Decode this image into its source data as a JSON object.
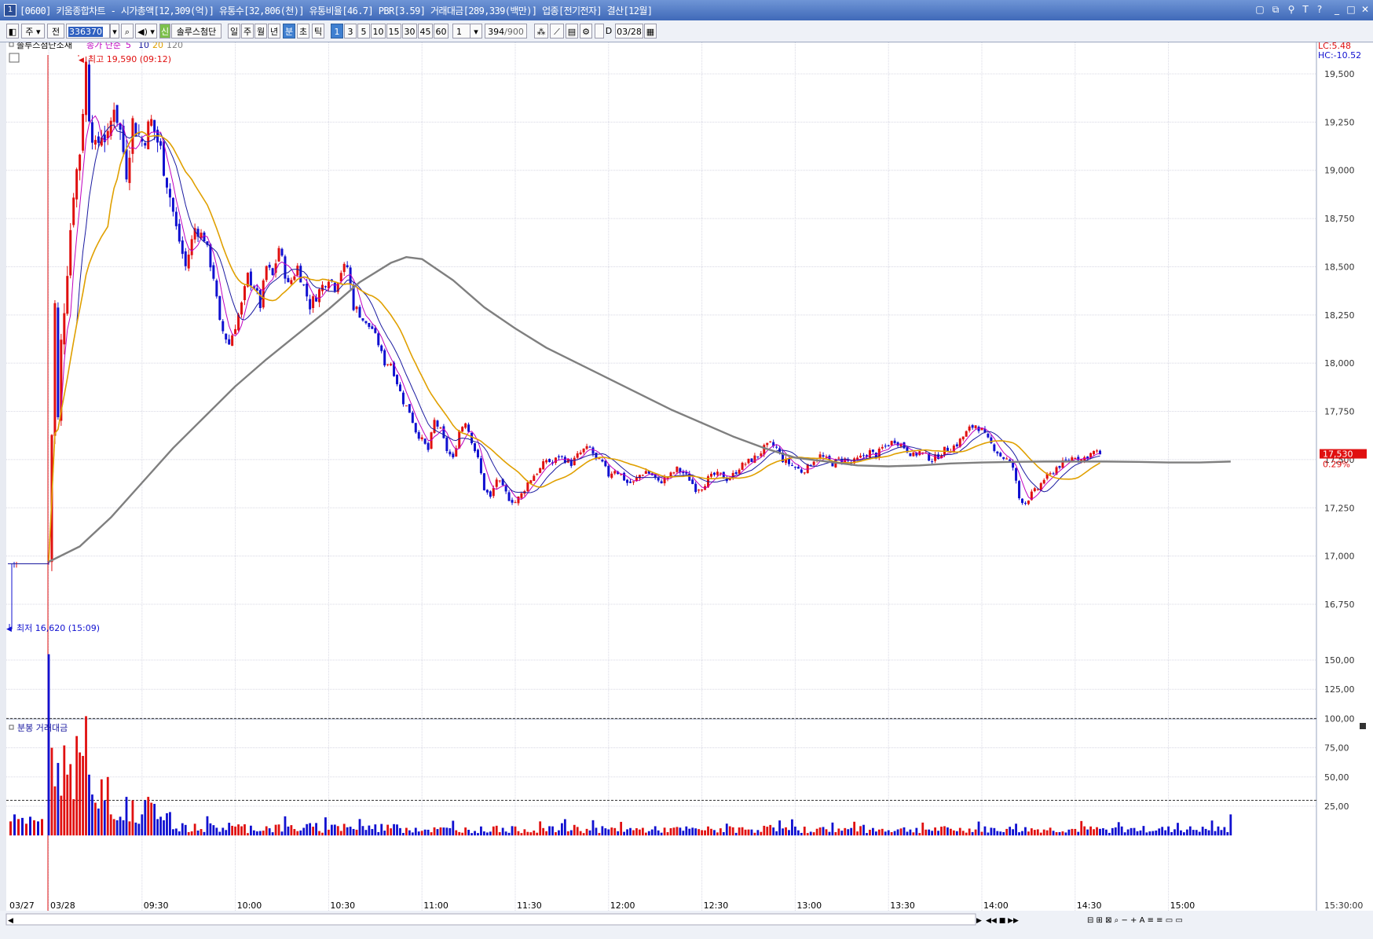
{
  "window": {
    "number": "1",
    "title": "[0600] 키움종합차트 - 시가총액[12,309(억)] 유통수[32,806(천)] 유통비율[46.7] PBR[3.59] 거래대금[289,339(백만)] 업종[전기전자] 결산[12월]",
    "buttons": [
      "restore-icon",
      "tile-icon",
      "pin-icon",
      "font-icon",
      "help-icon",
      "minimize-icon",
      "maximize-icon",
      "close-icon"
    ]
  },
  "toolbar": {
    "market": "주",
    "all": "전",
    "code": "336370",
    "shin": "신",
    "stock_name": "솔루스첨단",
    "periods": [
      "일",
      "주",
      "월",
      "년",
      "분",
      "초",
      "틱"
    ],
    "selected_period": "분",
    "intervals": [
      "1",
      "3",
      "5",
      "10",
      "15",
      "30",
      "45",
      "60"
    ],
    "selected_interval": "1",
    "multiplier": "1",
    "count": "394",
    "count_max": "/900",
    "d_label": "D",
    "date": "03/28"
  },
  "legend": {
    "name": "솔루스첨단소재",
    "ma_label": "종가 단순",
    "ma_periods": [
      "5",
      "10",
      "20",
      "120"
    ],
    "ma_colors": [
      "#c000c0",
      "#1a1aa0",
      "#e0a000",
      "#7f7f7f"
    ]
  },
  "annotations": {
    "high": "최고 19,590 (09:12)",
    "low": "최저 16,620 (15:09)",
    "lc": "LC:5.48",
    "hc": "HC:-10.52",
    "last_price": "17,530",
    "last_change": "0.29%"
  },
  "colors": {
    "up": "#e01010",
    "down": "#1010d0",
    "grid": "#d8d8e4",
    "axis_bg": "#ffffff",
    "price_tag": "#e01010"
  },
  "volume": {
    "title": "분봉 거래대금"
  },
  "chart_data": [
    {
      "type": "candlestick",
      "title": "",
      "xlabel": "",
      "ylabel": "",
      "ylim": [
        16620,
        19700
      ],
      "y_ticks": [
        "19,500",
        "19,250",
        "19,000",
        "18,750",
        "18,500",
        "18,250",
        "18,000",
        "17,750",
        "17,500",
        "17,250",
        "17,000",
        "16,750"
      ],
      "y_tick_values": [
        19500,
        19250,
        19000,
        18750,
        18500,
        18250,
        18000,
        17750,
        17500,
        17250,
        17000,
        16750
      ],
      "x_ticks": [
        "03/27",
        "03/28",
        "09:30",
        "10:00",
        "10:30",
        "11:00",
        "11:30",
        "12:00",
        "12:30",
        "13:00",
        "13:30",
        "14:00",
        "14:30",
        "15:00"
      ],
      "x_tick_minutes": [
        null,
        0,
        30,
        60,
        90,
        120,
        150,
        180,
        210,
        240,
        270,
        300,
        330,
        360
      ],
      "high": 19590,
      "low": 16620,
      "last": 17530,
      "price_path_minutes": [
        0,
        2,
        3,
        4,
        6,
        8,
        10,
        12,
        13,
        15,
        17,
        19,
        21,
        23,
        25,
        27,
        30,
        33,
        36,
        38,
        41,
        44,
        47,
        50,
        53,
        55,
        58,
        60,
        62,
        64,
        66,
        68,
        70,
        72,
        74,
        77,
        80,
        82,
        84,
        86,
        88,
        90,
        92,
        94,
        96,
        98,
        100,
        102,
        104,
        106,
        108,
        110,
        112,
        114,
        116,
        118,
        120,
        122,
        124,
        126,
        128,
        130,
        132,
        134,
        136,
        138,
        140,
        142,
        144,
        146,
        148,
        150,
        152,
        154,
        156,
        158,
        160,
        162,
        164,
        166,
        168,
        170,
        172,
        174,
        176,
        178,
        180,
        182,
        184,
        186,
        188,
        190,
        192,
        194,
        196,
        198,
        200,
        202,
        204,
        206,
        208,
        210,
        212,
        214,
        216,
        218,
        220,
        222,
        224,
        226,
        228,
        230,
        232,
        234,
        236,
        238,
        240,
        242,
        244,
        246,
        248,
        250,
        252,
        254,
        256,
        258,
        260,
        262,
        264,
        266,
        268,
        270,
        272,
        274,
        276,
        278,
        280,
        282,
        284,
        286,
        288,
        290,
        292,
        294,
        296,
        298,
        300,
        302,
        304,
        306,
        308,
        310,
        312,
        314,
        316,
        318,
        320,
        322,
        324,
        326,
        328,
        330,
        332,
        334,
        336,
        338,
        340,
        342,
        344,
        346,
        348,
        350,
        352,
        354,
        356,
        358,
        360,
        362,
        364,
        366,
        368,
        370,
        372,
        374,
        376,
        378,
        380
      ],
      "price_path_values": [
        16970,
        18300,
        17700,
        18100,
        18500,
        18900,
        19100,
        19550,
        19300,
        19100,
        19200,
        19150,
        19350,
        19200,
        19000,
        19250,
        19150,
        19250,
        19100,
        18950,
        18700,
        18500,
        18700,
        18650,
        18450,
        18200,
        18100,
        18200,
        18300,
        18450,
        18400,
        18300,
        18500,
        18450,
        18600,
        18400,
        18500,
        18400,
        18300,
        18350,
        18400,
        18450,
        18400,
        18480,
        18500,
        18300,
        18250,
        18200,
        18180,
        18100,
        18000,
        18000,
        17900,
        17800,
        17750,
        17650,
        17600,
        17550,
        17700,
        17650,
        17550,
        17500,
        17650,
        17700,
        17600,
        17500,
        17350,
        17300,
        17400,
        17350,
        17300,
        17280,
        17320,
        17380,
        17420,
        17450,
        17500,
        17480,
        17520,
        17500,
        17480,
        17520,
        17550,
        17560,
        17500,
        17480,
        17420,
        17450,
        17420,
        17380,
        17380,
        17420,
        17440,
        17420,
        17380,
        17400,
        17420,
        17450,
        17430,
        17400,
        17350,
        17360,
        17400,
        17420,
        17420,
        17400,
        17420,
        17460,
        17480,
        17500,
        17520,
        17560,
        17580,
        17560,
        17500,
        17480,
        17460,
        17440,
        17460,
        17500,
        17520,
        17500,
        17480,
        17500,
        17500,
        17480,
        17500,
        17520,
        17540,
        17520,
        17560,
        17580,
        17600,
        17580,
        17550,
        17520,
        17540,
        17520,
        17500,
        17520,
        17550,
        17560,
        17580,
        17620,
        17660,
        17680,
        17650,
        17600,
        17560,
        17520,
        17500,
        17460,
        17300,
        17280,
        17320,
        17350,
        17400,
        17420,
        17460,
        17480,
        17500,
        17520,
        17500,
        17520,
        17540,
        17530
      ],
      "ma120_minutes": [
        0,
        10,
        20,
        30,
        40,
        50,
        60,
        70,
        80,
        90,
        100,
        110,
        115,
        120,
        130,
        140,
        150,
        160,
        170,
        180,
        190,
        200,
        210,
        220,
        230,
        240,
        250,
        260,
        270,
        280,
        290,
        300,
        310,
        320,
        330,
        340,
        350,
        360,
        370,
        380
      ],
      "ma120_values": [
        16970,
        17050,
        17200,
        17380,
        17560,
        17720,
        17880,
        18020,
        18150,
        18280,
        18420,
        18520,
        18550,
        18540,
        18430,
        18290,
        18180,
        18080,
        18000,
        17920,
        17840,
        17760,
        17690,
        17620,
        17560,
        17510,
        17490,
        17470,
        17465,
        17470,
        17480,
        17485,
        17488,
        17490,
        17490,
        17490,
        17488,
        17485,
        17485,
        17490
      ]
    },
    {
      "type": "bar",
      "title": "분봉 거래대금",
      "ylim": [
        0,
        160
      ],
      "y_ticks": [
        "150,00",
        "125,00",
        "100,00",
        "75,00",
        "50,00",
        "25,00"
      ],
      "y_tick_values": [
        150,
        125,
        100,
        75,
        50,
        25
      ],
      "reference_lines": [
        100,
        30
      ],
      "x_axis_end_label": "15:30:00",
      "early_minutes": [
        0,
        1,
        2,
        3,
        4,
        5,
        6,
        7,
        8,
        9,
        10,
        11,
        12,
        13,
        14,
        15,
        16,
        17,
        18,
        19,
        20,
        21,
        22,
        23,
        24,
        25,
        26,
        27,
        28,
        29,
        30,
        31,
        32,
        33,
        34,
        35,
        36,
        37,
        38,
        39
      ],
      "early_values": [
        155,
        75,
        42,
        62,
        34,
        77,
        52,
        61,
        31,
        85,
        71,
        68,
        102,
        52,
        35,
        28,
        23,
        48,
        30,
        50,
        18,
        14,
        13,
        16,
        13,
        33,
        12,
        30,
        11,
        10,
        18,
        30,
        33,
        28,
        27,
        14,
        16,
        13,
        19,
        20
      ]
    }
  ]
}
